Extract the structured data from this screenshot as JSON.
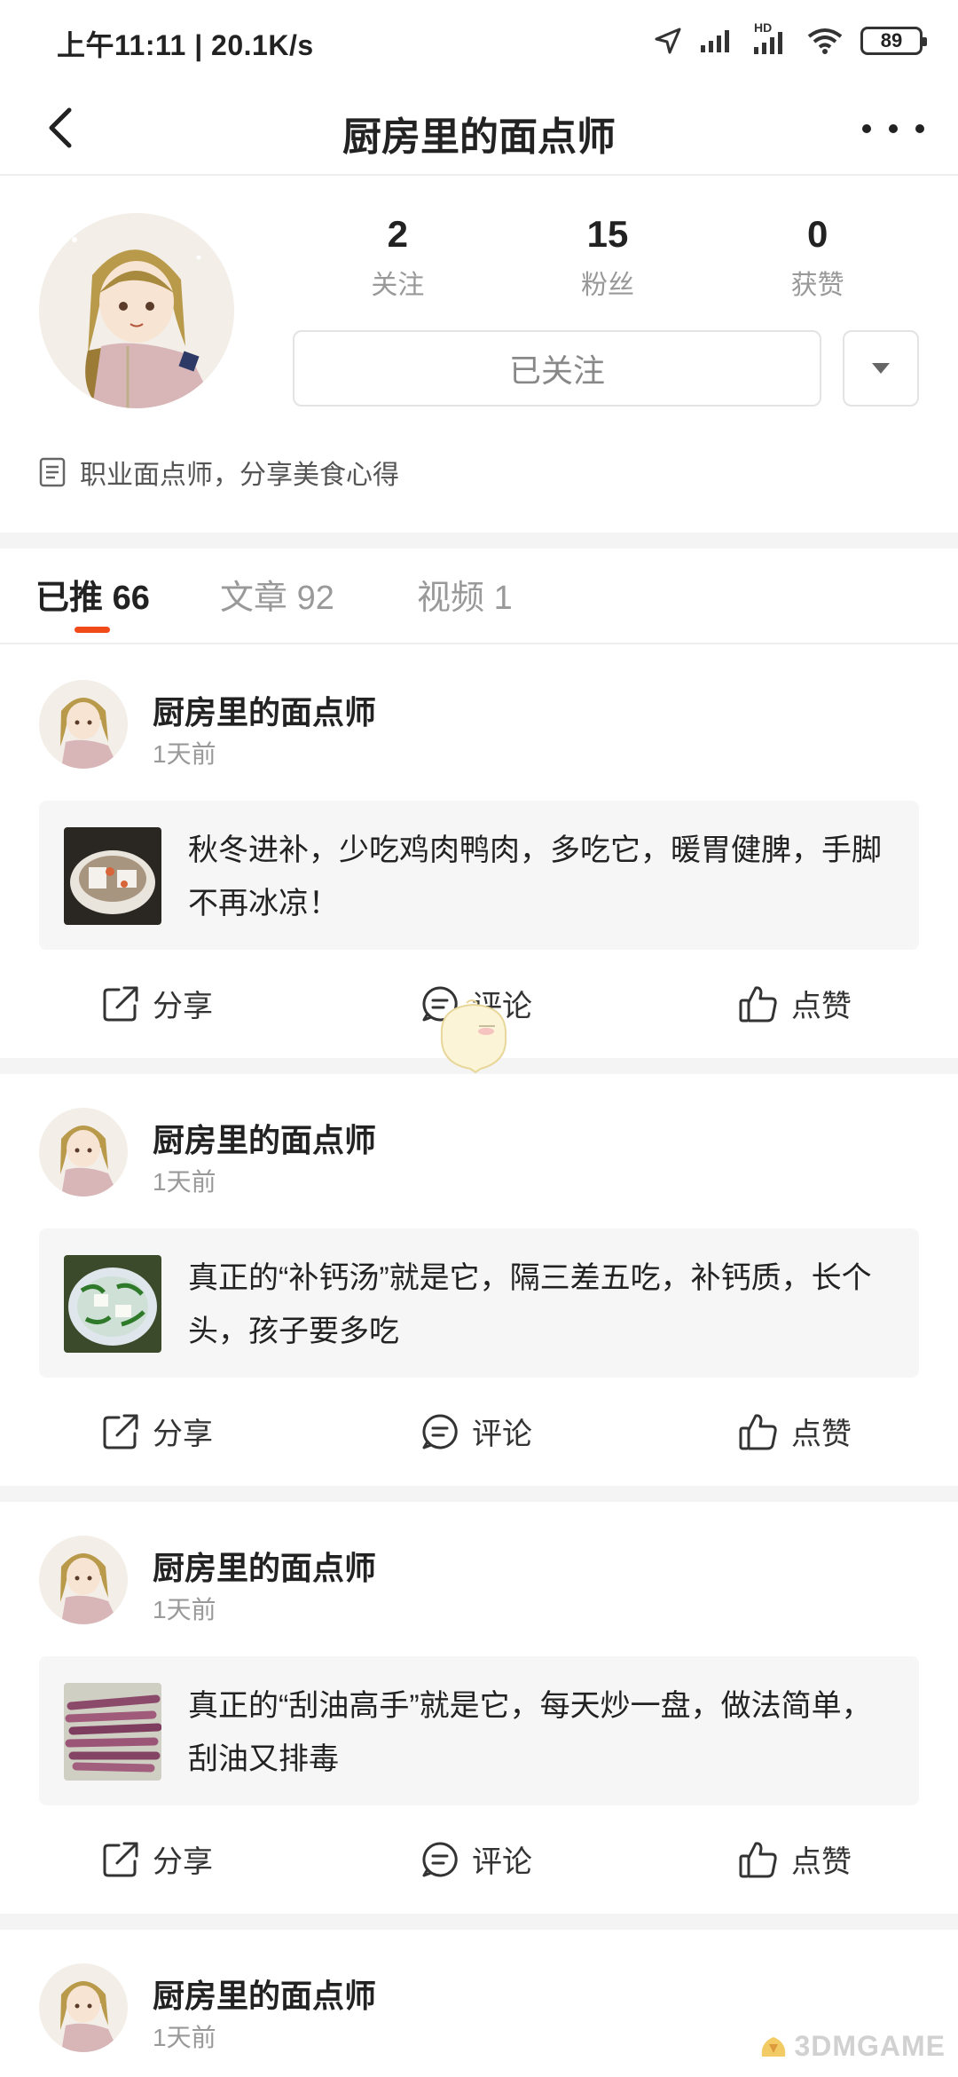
{
  "status_bar": {
    "time_speed": "上午11:11 | 20.1K/s",
    "hd_label": "HD",
    "battery": "89"
  },
  "nav": {
    "title": "厨房里的面点师"
  },
  "profile": {
    "stats": [
      {
        "value": "2",
        "label": "关注"
      },
      {
        "value": "15",
        "label": "粉丝"
      },
      {
        "value": "0",
        "label": "获赞"
      }
    ],
    "follow_button": "已关注",
    "bio": "职业面点师，分享美食心得"
  },
  "tabs": [
    {
      "label": "已推",
      "count": "66",
      "active": true
    },
    {
      "label": "文章",
      "count": "92",
      "active": false
    },
    {
      "label": "视频",
      "count": "1",
      "active": false
    }
  ],
  "posts": [
    {
      "author": "厨房里的面点师",
      "time": "1天前",
      "text": "秋冬进补，少吃鸡肉鸭肉，多吃它，暖胃健脾，手脚不再冰凉！",
      "thumb": "radish-stew"
    },
    {
      "author": "厨房里的面点师",
      "time": "1天前",
      "text": "真正的“补钙汤”就是它，隔三差五吃，补钙质，长个头，孩子要多吃",
      "thumb": "tofu-greens-soup"
    },
    {
      "author": "厨房里的面点师",
      "time": "1天前",
      "text": "真正的“刮油高手”就是它，每天炒一盘，做法简单，刮油又排毒",
      "thumb": "purple-shallots"
    },
    {
      "author": "厨房里的面点师",
      "time": "1天前"
    }
  ],
  "actions": {
    "share": "分享",
    "comment": "评论",
    "like": "点赞"
  },
  "watermark": "3DMGAME",
  "colors": {
    "accent": "#f04a19",
    "text_primary": "#222222",
    "text_secondary": "#999999",
    "card_bg": "#f6f6f6"
  }
}
